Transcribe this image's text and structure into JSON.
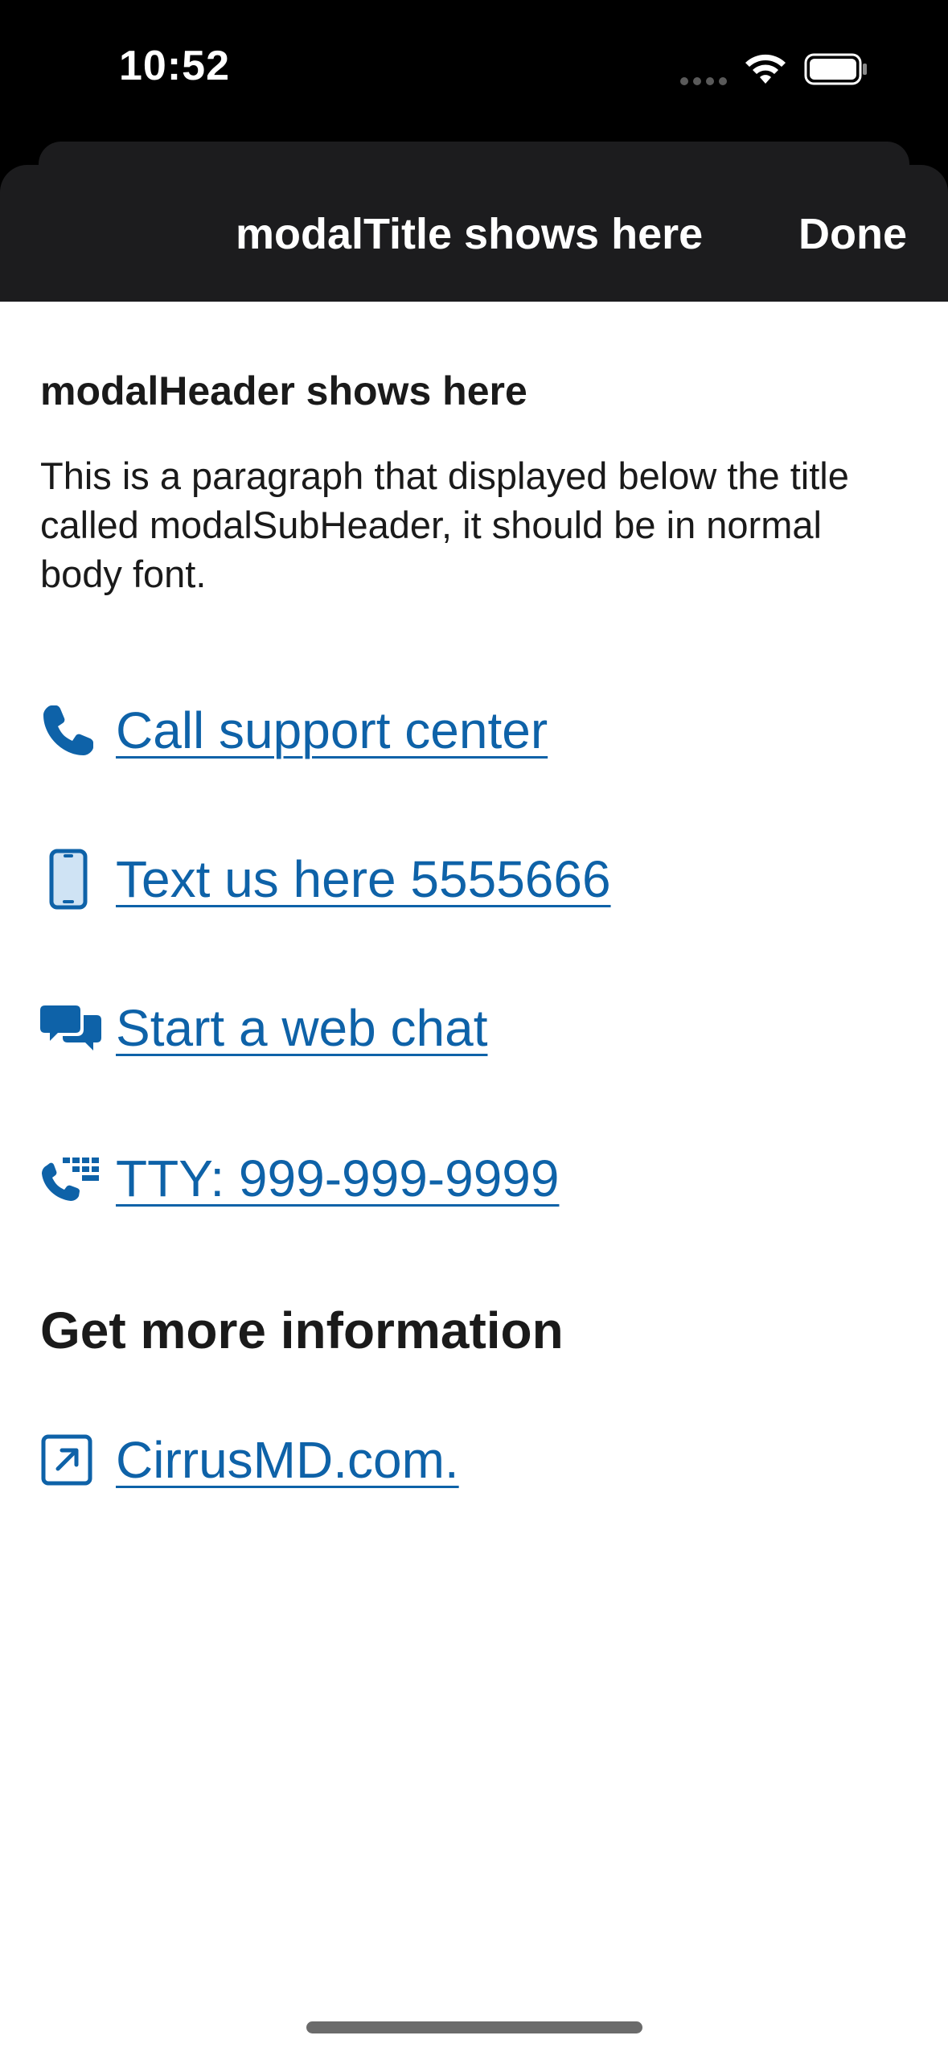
{
  "status_bar": {
    "time": "10:52",
    "icons": [
      "cellular-signal-icon",
      "wifi-icon",
      "battery-icon"
    ]
  },
  "modal": {
    "title": "modalTitle shows here",
    "done_label": "Done",
    "header": "modalHeader shows here",
    "subheader": "This is a paragraph that displayed below the title called modalSubHeader, it should be in normal body font.",
    "links": [
      {
        "icon": "phone-icon",
        "label": "Call support center"
      },
      {
        "icon": "mobile-phone-icon",
        "label": "Text us here 5555666"
      },
      {
        "icon": "chat-bubbles-icon",
        "label": "Start a web chat"
      },
      {
        "icon": "tty-phone-icon",
        "label": "TTY: 999-999-9999"
      }
    ],
    "more_info_heading": "Get more information",
    "external_link": {
      "icon": "external-link-icon",
      "label": "CirrusMD.com."
    }
  },
  "colors": {
    "link": "#0e62a8",
    "header_background": "#1c1c1e",
    "status_bar_background": "#000000",
    "content_background": "#ffffff",
    "text": "#1a1a1a"
  }
}
